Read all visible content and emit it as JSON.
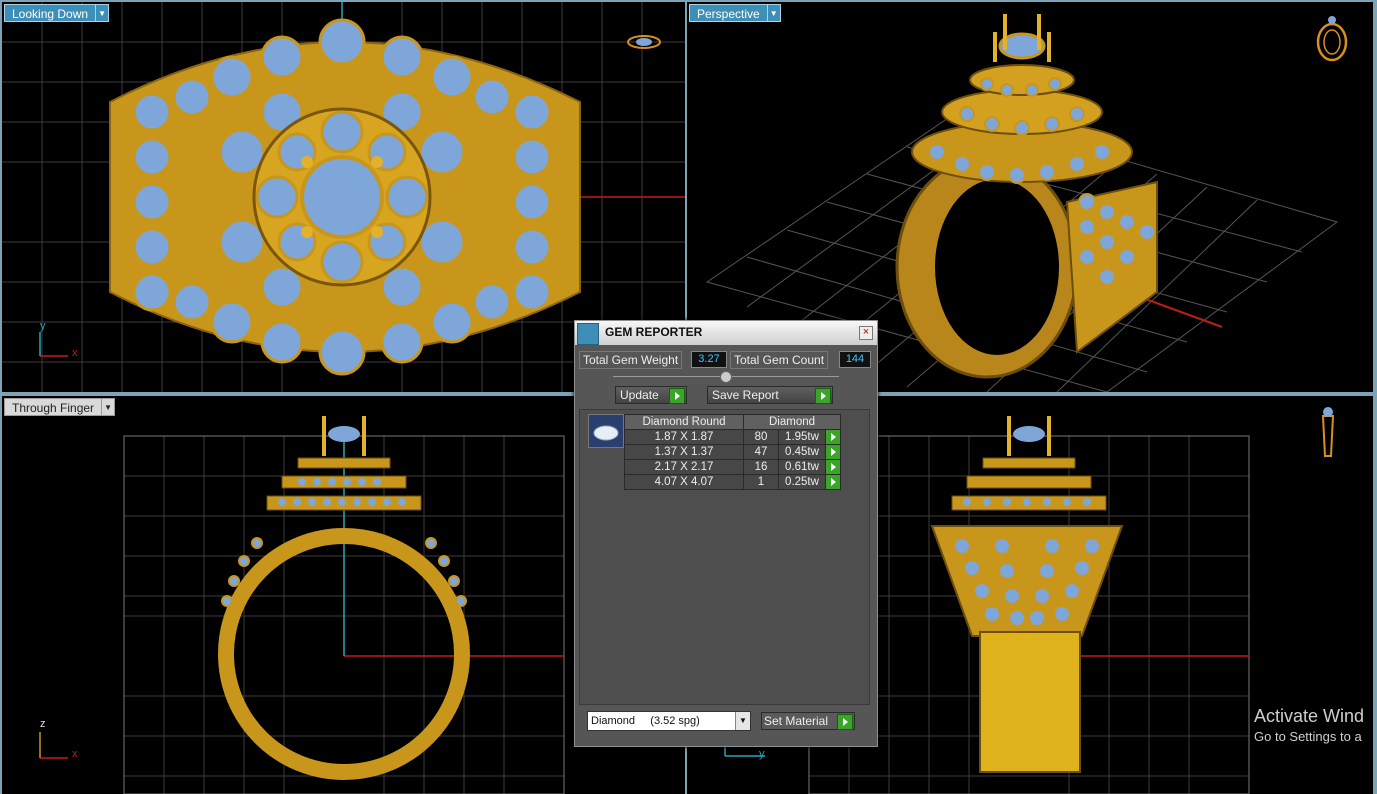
{
  "viewports": {
    "top_left": {
      "label": "Looking Down",
      "axis_y": "y",
      "axis_x": "x"
    },
    "top_right": {
      "label": "Perspective"
    },
    "bottom_left": {
      "label": "Through Finger",
      "axis_y": "z",
      "axis_x": "x"
    },
    "bottom_right": {
      "axis_y": "y"
    }
  },
  "gem_reporter": {
    "title": "GEM REPORTER",
    "close": "×",
    "total_gem_weight_label": "Total Gem Weight",
    "total_gem_weight_value": "3.27",
    "total_gem_count_label": "Total Gem Count",
    "total_gem_count_value": "144",
    "update_label": "Update",
    "save_report_label": "Save Report",
    "table": {
      "header_cut": "Diamond Round",
      "header_material": "Diamond",
      "rows": [
        {
          "size": "1.87 X 1.87",
          "count": "80",
          "weight": "1.95tw"
        },
        {
          "size": "1.37 X 1.37",
          "count": "47",
          "weight": "0.45tw"
        },
        {
          "size": "2.17 X 2.17",
          "count": "16",
          "weight": "0.61tw"
        },
        {
          "size": "4.07 X 4.07",
          "count": "1",
          "weight": "0.25tw"
        }
      ]
    },
    "material_select": "Diamond     (3.52 spg)",
    "set_material_label": "Set Material"
  },
  "watermark": {
    "line1": "Activate Wind",
    "line2": "Go to Settings to a"
  },
  "colors": {
    "gold": "#c8961a",
    "gem": "#7fa6d8",
    "label_bg": "#3e8fb8",
    "grid": "#4a4a4a"
  }
}
